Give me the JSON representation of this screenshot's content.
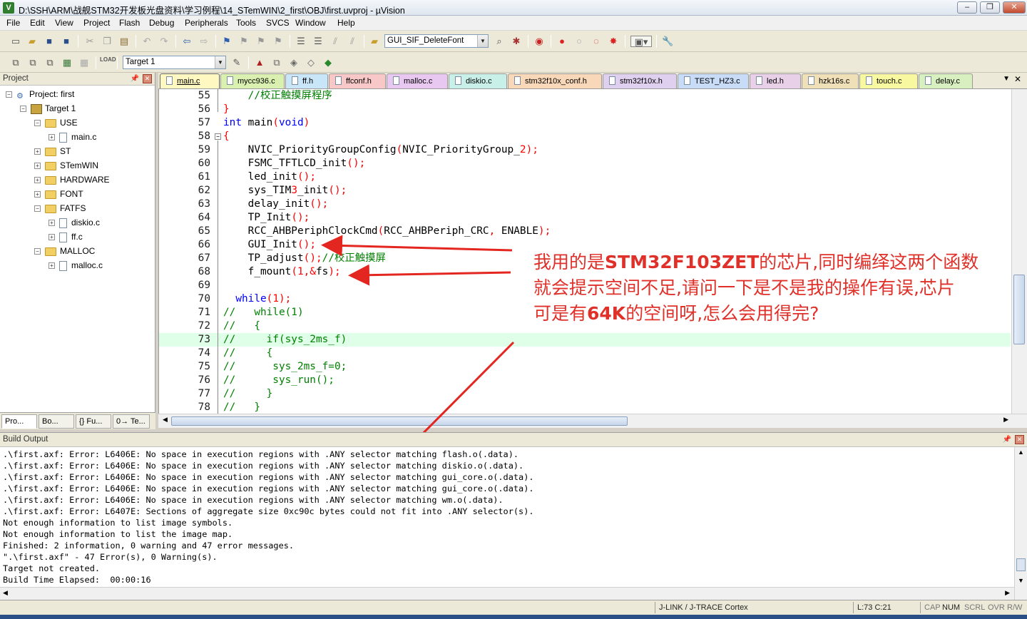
{
  "window": {
    "title": "D:\\SSH\\ARM\\战舰STM32开发板光盘资料\\学习例程\\14_STemWIN\\2_first\\OBJ\\first.uvproj - µVision",
    "app_icon": "V",
    "minimize": "–",
    "restore": "❐",
    "close": "✕"
  },
  "menu": [
    "File",
    "Edit",
    "View",
    "Project",
    "Flash",
    "Debug",
    "Peripherals",
    "Tools",
    "SVCS",
    "Window",
    "Help"
  ],
  "toolbar": {
    "function_combo": "GUI_SIF_DeleteFont",
    "target_combo": "Target 1",
    "load_label": "LOAD"
  },
  "project_panel": {
    "title": "Project",
    "tree": [
      {
        "label": "Project: first",
        "kind": "project"
      },
      {
        "label": "Target 1",
        "kind": "target"
      },
      {
        "label": "USE",
        "kind": "folder"
      },
      {
        "label": "main.c",
        "kind": "file"
      },
      {
        "label": "ST",
        "kind": "folder"
      },
      {
        "label": "STemWIN",
        "kind": "folder"
      },
      {
        "label": "HARDWARE",
        "kind": "folder"
      },
      {
        "label": "FONT",
        "kind": "folder"
      },
      {
        "label": "FATFS",
        "kind": "folder"
      },
      {
        "label": "diskio.c",
        "kind": "file"
      },
      {
        "label": "ff.c",
        "kind": "file"
      },
      {
        "label": "MALLOC",
        "kind": "folder"
      },
      {
        "label": "malloc.c",
        "kind": "file"
      }
    ],
    "tabs": [
      "Pro...",
      "Bo...",
      "{} Fu...",
      "0→ Te..."
    ]
  },
  "editor_tabs": [
    {
      "label": "main.c",
      "color": "#f8e878",
      "active": true
    },
    {
      "label": "mycc936.c",
      "color": "#d9f0b0"
    },
    {
      "label": "ff.h",
      "color": "#c8e6f8"
    },
    {
      "label": "ffconf.h",
      "color": "#f8c8c8"
    },
    {
      "label": "malloc.c",
      "color": "#e8c8f0"
    },
    {
      "label": "diskio.c",
      "color": "#c8f0e8"
    },
    {
      "label": "stm32f10x_conf.h",
      "color": "#f8d8b8"
    },
    {
      "label": "stm32f10x.h",
      "color": "#e0d0f0"
    },
    {
      "label": "TEST_HZ3.c",
      "color": "#c8dcf8"
    },
    {
      "label": "led.h",
      "color": "#e8d0e8"
    },
    {
      "label": "hzk16s.c",
      "color": "#f0e0b8"
    },
    {
      "label": "touch.c",
      "color": "#f8f8a0"
    },
    {
      "label": "delay.c",
      "color": "#d8f0c0"
    }
  ],
  "code_lines": [
    {
      "num": "55",
      "text": "    //校正触摸屏程序"
    },
    {
      "num": "56",
      "text": "}"
    },
    {
      "num": "57",
      "text": "int main(void)"
    },
    {
      "num": "58",
      "text": "{"
    },
    {
      "num": "59",
      "text": "    NVIC_PriorityGroupConfig(NVIC_PriorityGroup_2);"
    },
    {
      "num": "60",
      "text": "    FSMC_TFTLCD_init();"
    },
    {
      "num": "61",
      "text": "    led_init();"
    },
    {
      "num": "62",
      "text": "    sys_TIM3_init();"
    },
    {
      "num": "63",
      "text": "    delay_init();"
    },
    {
      "num": "64",
      "text": "    TP_Init();"
    },
    {
      "num": "65",
      "text": "    RCC_AHBPeriphClockCmd(RCC_AHBPeriph_CRC, ENABLE);"
    },
    {
      "num": "66",
      "text": "    GUI_Init();"
    },
    {
      "num": "67",
      "text": "    TP_adjust();//校正触摸屏"
    },
    {
      "num": "68",
      "text": "    f_mount(1,&fs);"
    },
    {
      "num": "69",
      "text": ""
    },
    {
      "num": "70",
      "text": "  while(1);"
    },
    {
      "num": "71",
      "text": "//   while(1)"
    },
    {
      "num": "72",
      "text": "//   {"
    },
    {
      "num": "73",
      "text": "//     if(sys_2ms_f)",
      "highlight": true
    },
    {
      "num": "74",
      "text": "//     {"
    },
    {
      "num": "75",
      "text": "//      sys_2ms_f=0;"
    },
    {
      "num": "76",
      "text": "//      sys_run();"
    },
    {
      "num": "77",
      "text": "//     }"
    },
    {
      "num": "78",
      "text": "//   }"
    }
  ],
  "annotation": {
    "line1": "我用的是STM32F103ZET的芯片,同时编绎这两个函数",
    "line2": "就会提示空间不足,请问一下是不是我的操作有误,芯片",
    "line3": "可是有64K的空间呀,怎么会用得完?"
  },
  "build_output": {
    "title": "Build Output",
    "lines": [
      ".\\first.axf: Error: L6406E: No space in execution regions with .ANY selector matching flash.o(.data).",
      ".\\first.axf: Error: L6406E: No space in execution regions with .ANY selector matching diskio.o(.data).",
      ".\\first.axf: Error: L6406E: No space in execution regions with .ANY selector matching gui_core.o(.data).",
      ".\\first.axf: Error: L6406E: No space in execution regions with .ANY selector matching gui_core.o(.data).",
      ".\\first.axf: Error: L6406E: No space in execution regions with .ANY selector matching wm.o(.data).",
      ".\\first.axf: Error: L6407E: Sections of aggregate size 0xc90c bytes could not fit into .ANY selector(s).",
      "Not enough information to list image symbols.",
      "Not enough information to list the image map.",
      "Finished: 2 information, 0 warning and 47 error messages.",
      "\".\\first.axf\" - 47 Error(s), 0 Warning(s).",
      "Target not created.",
      "Build Time Elapsed:  00:00:16"
    ]
  },
  "statusbar": {
    "debugger": "J-LINK / J-TRACE Cortex",
    "position": "L:73 C:21",
    "cap": "CAP",
    "num": "NUM",
    "scrl": "SCRL",
    "ovr": "OVR",
    "rw": "R/W"
  }
}
